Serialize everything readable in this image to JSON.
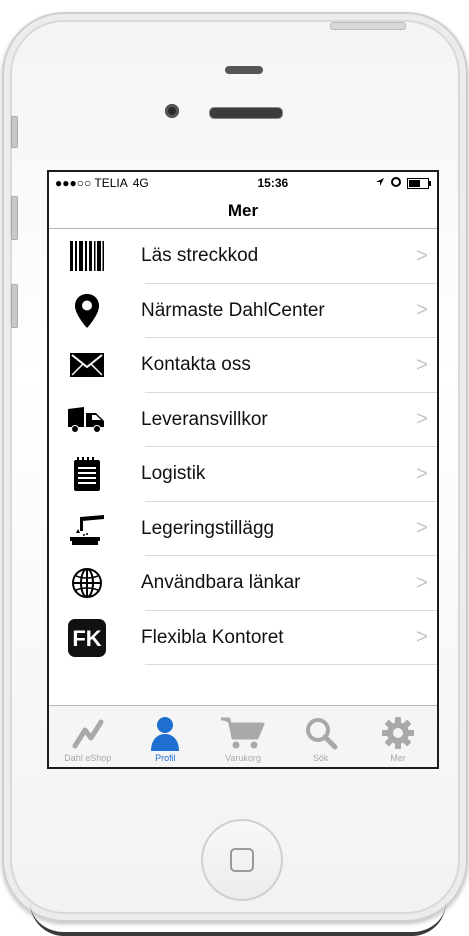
{
  "status_bar": {
    "carrier": "●●●○○ TELIA",
    "network": "4G",
    "time": "15:36",
    "battery_level": 0.7
  },
  "nav": {
    "title": "Mer"
  },
  "menu": [
    {
      "label": "Läs streckkod",
      "icon": "barcode-icon"
    },
    {
      "label": "Närmaste DahlCenter",
      "icon": "location-pin-icon"
    },
    {
      "label": "Kontakta oss",
      "icon": "envelope-icon"
    },
    {
      "label": "Leveransvillkor",
      "icon": "truck-icon"
    },
    {
      "label": "Logistik",
      "icon": "notepad-icon"
    },
    {
      "label": "Legeringstillägg",
      "icon": "furnace-icon"
    },
    {
      "label": "Användbara länkar",
      "icon": "globe-icon"
    },
    {
      "label": "Flexibla Kontoret",
      "icon": "fk-logo-icon",
      "logo_text": "FK"
    }
  ],
  "tabs": [
    {
      "label": "Dahl eShop",
      "icon": "eshop-icon",
      "active": false
    },
    {
      "label": "Profil",
      "icon": "person-icon",
      "active": true
    },
    {
      "label": "Varukorg",
      "icon": "cart-icon",
      "active": false
    },
    {
      "label": "Sök",
      "icon": "search-icon",
      "active": false
    },
    {
      "label": "Mer",
      "icon": "gear-icon",
      "active": false
    }
  ],
  "colors": {
    "accent": "#1e6fd0",
    "inactive": "#a9a9a9",
    "chevron": "#c3c3c3"
  }
}
